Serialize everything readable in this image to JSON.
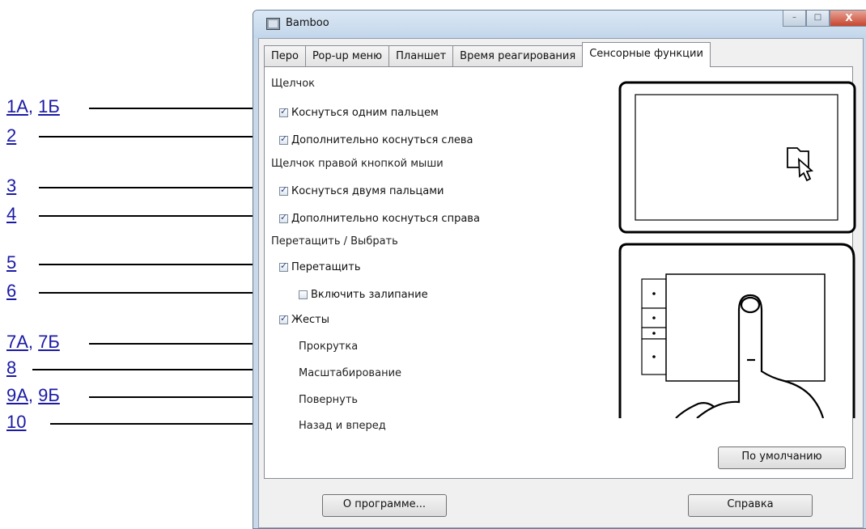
{
  "callouts": [
    {
      "parts": [
        "1А",
        "1Б"
      ]
    },
    {
      "parts": [
        "2"
      ]
    },
    {
      "parts": [
        "3"
      ]
    },
    {
      "parts": [
        "4"
      ]
    },
    {
      "parts": [
        "5"
      ]
    },
    {
      "parts": [
        "6"
      ]
    },
    {
      "parts": [
        "7А",
        "7Б"
      ]
    },
    {
      "parts": [
        "8"
      ]
    },
    {
      "parts": [
        "9А",
        "9Б"
      ]
    },
    {
      "parts": [
        "10"
      ]
    }
  ],
  "window": {
    "title": "Bamboo",
    "controls": {
      "minimize": "–",
      "maximize": "□",
      "close": "X"
    }
  },
  "tabs": [
    "Перо",
    "Pop-up меню",
    "Планшет",
    "Время реагирования",
    "Сенсорные функции"
  ],
  "active_tab": "Сенсорные функции",
  "sections": {
    "click": "Щелчок",
    "right_click": "Щелчок правой кнопкой мыши",
    "drag_select": "Перетащить / Выбрать"
  },
  "options": {
    "tap_one_finger": {
      "label": "Коснуться одним пальцем",
      "checked": true
    },
    "additional_tap_left": {
      "label": "Дополнительно коснуться слева",
      "checked": true
    },
    "tap_two_fingers": {
      "label": "Коснуться двумя пальцами",
      "checked": true
    },
    "additional_tap_right": {
      "label": "Дополнительно коснуться справа",
      "checked": true
    },
    "drag": {
      "label": "Перетащить",
      "checked": true
    },
    "drag_lock": {
      "label": "Включить залипание",
      "checked": false
    },
    "gestures": {
      "label": "Жесты",
      "checked": true
    }
  },
  "gesture_items": [
    "Прокрутка",
    "Масштабирование",
    "Повернуть",
    "Назад и вперед"
  ],
  "buttons": {
    "default": "По умолчанию",
    "about": "О программе...",
    "help": "Справка"
  },
  "colors": {
    "link": "#1a1aa6",
    "title_bar": "#c9d9ea",
    "checkmark": "#2b3f8f"
  }
}
